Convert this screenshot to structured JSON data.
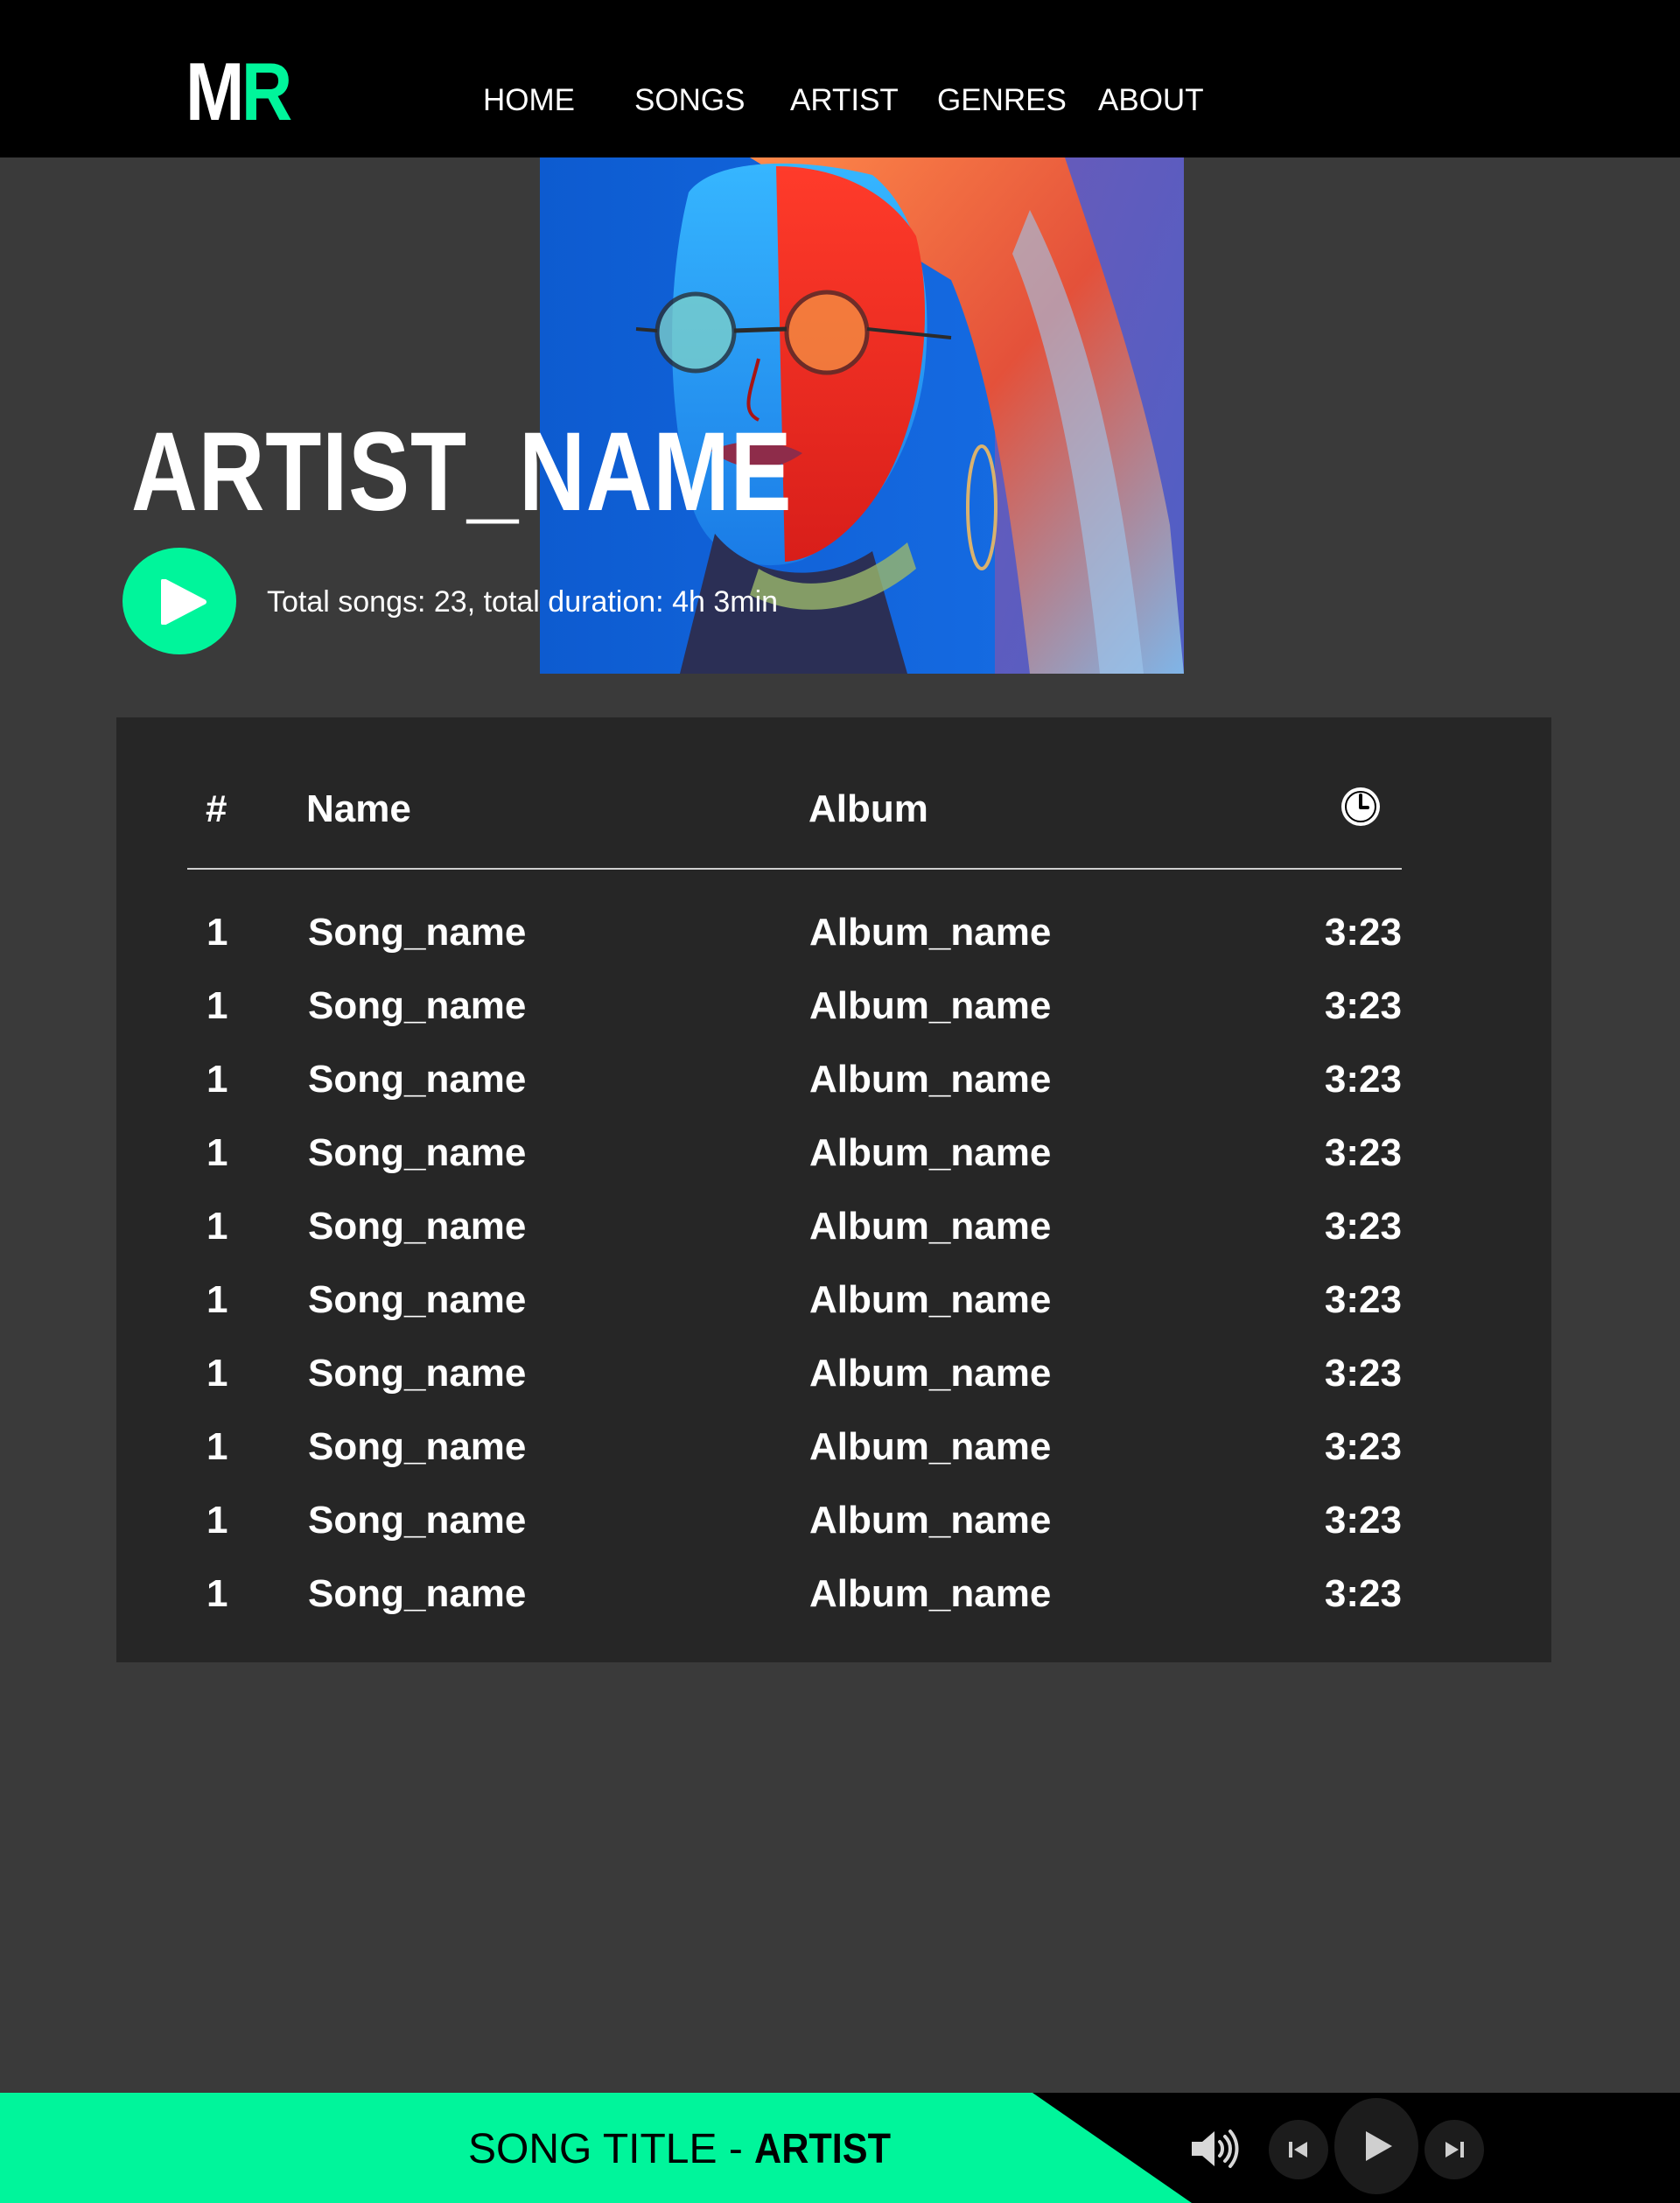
{
  "logo": {
    "letter1": "M",
    "letter2": "R"
  },
  "nav": {
    "items": [
      "HOME",
      "SONGS",
      "ARTIST",
      "GENRES",
      "ABOUT"
    ]
  },
  "hero": {
    "artist_name": "ARTIST_NAME",
    "stats": "Total songs: 23, total duration: 4h 3min"
  },
  "table": {
    "headers": {
      "num": "#",
      "name": "Name",
      "album": "Album",
      "duration_icon": "clock-icon"
    },
    "rows": [
      {
        "num": "1",
        "name": "Song_name",
        "album": "Album_name",
        "duration": "3:23"
      },
      {
        "num": "1",
        "name": "Song_name",
        "album": "Album_name",
        "duration": "3:23"
      },
      {
        "num": "1",
        "name": "Song_name",
        "album": "Album_name",
        "duration": "3:23"
      },
      {
        "num": "1",
        "name": "Song_name",
        "album": "Album_name",
        "duration": "3:23"
      },
      {
        "num": "1",
        "name": "Song_name",
        "album": "Album_name",
        "duration": "3:23"
      },
      {
        "num": "1",
        "name": "Song_name",
        "album": "Album_name",
        "duration": "3:23"
      },
      {
        "num": "1",
        "name": "Song_name",
        "album": "Album_name",
        "duration": "3:23"
      },
      {
        "num": "1",
        "name": "Song_name",
        "album": "Album_name",
        "duration": "3:23"
      },
      {
        "num": "1",
        "name": "Song_name",
        "album": "Album_name",
        "duration": "3:23"
      },
      {
        "num": "1",
        "name": "Song_name",
        "album": "Album_name",
        "duration": "3:23"
      }
    ]
  },
  "player": {
    "song_title": "SONG TITLE",
    "separator": " - ",
    "artist": "ARTIST",
    "controls": [
      "volume-icon",
      "previous-icon",
      "play-icon",
      "next-icon"
    ]
  },
  "colors": {
    "accent": "#00f59b",
    "background": "#3a3a3a",
    "panel": "#262626",
    "bar": "#000000"
  }
}
